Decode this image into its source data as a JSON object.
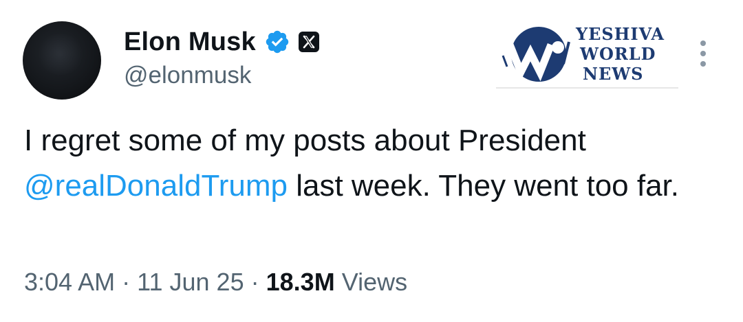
{
  "author": {
    "display_name": "Elon Musk",
    "handle": "@elonmusk",
    "verified": true,
    "affiliation_badge": "x-logo-icon"
  },
  "watermark": {
    "line1": "YESHIVA",
    "line2": "WORLD",
    "line3": "NEWS",
    "color": "#1d3b72"
  },
  "tweet": {
    "text_before": "I regret some of my posts about President ",
    "mention": "@realDonaldTrump",
    "text_after": " last week. They went too far."
  },
  "meta": {
    "time": "3:04 AM",
    "separator": "·",
    "date": "11 Jun 25",
    "views_count": "18.3M",
    "views_label": "Views"
  },
  "colors": {
    "text": "#0f1419",
    "secondary": "#536471",
    "link": "#1d9bf0",
    "verified": "#1d9bf0"
  }
}
